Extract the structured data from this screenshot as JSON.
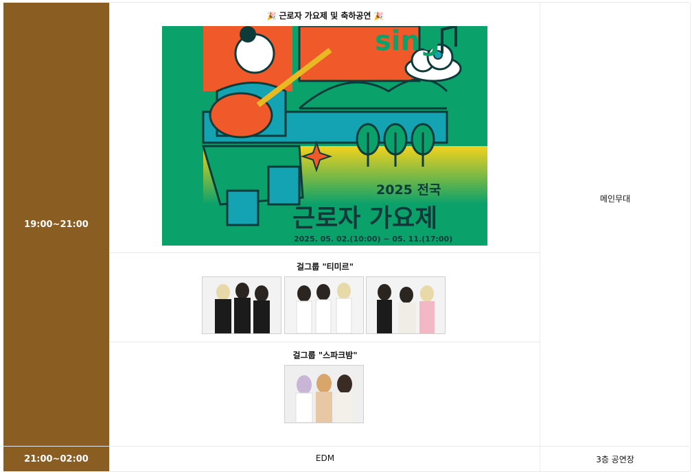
{
  "schedule": [
    {
      "time": "19:00~21:00",
      "venue": "메인무대",
      "sections": [
        {
          "title": "근로자 가요제  및  축하공연",
          "title_icon": "party-popper-icon"
        },
        {
          "title": "걸그룹 \"티미르\""
        },
        {
          "title": "걸그룹 \"스파크밤\""
        }
      ]
    },
    {
      "time": "21:00~02:00",
      "program": "EDM",
      "venue": "3층 공연장"
    }
  ],
  "poster": {
    "word": "sing",
    "year_region": "2025 전국",
    "name": "근로자 가요제",
    "period": "2025. 05. 02.(10:00) ~ 05. 11.(17:00)"
  },
  "colors": {
    "time_cell_bg": "#8a5d22",
    "poster_green": "#0aa16b",
    "poster_orange": "#f05a2a",
    "poster_yellow": "#f2d21d",
    "poster_teal": "#14a3b3"
  }
}
